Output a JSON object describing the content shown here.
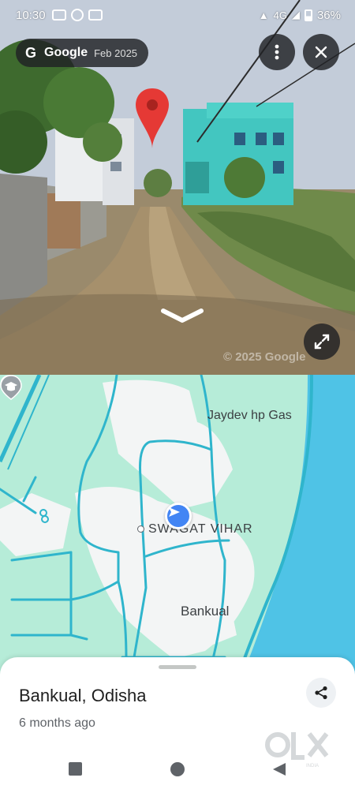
{
  "status_bar": {
    "time": "10:30",
    "network": "4G",
    "battery": "36%"
  },
  "street_view": {
    "provider": "Google",
    "capture_date": "Feb 2025",
    "watermark": "© 2025 Google"
  },
  "map": {
    "labels": {
      "gas_station": "Jaydev hp Gas",
      "neighborhood": "SWAGAT VIHAR",
      "locality": "Bankual"
    }
  },
  "place_sheet": {
    "title": "Bankual, Odisha",
    "subtitle": "6 months ago"
  },
  "overlay": {
    "logo": "OLX",
    "logo_caption": "INDIA"
  },
  "colors": {
    "map_green": "#b6ecd8",
    "road_cyan": "#2fb5cc",
    "water_blue": "#4fc3e6",
    "nav_blue": "#4285f4",
    "pin_red": "#e53935"
  }
}
